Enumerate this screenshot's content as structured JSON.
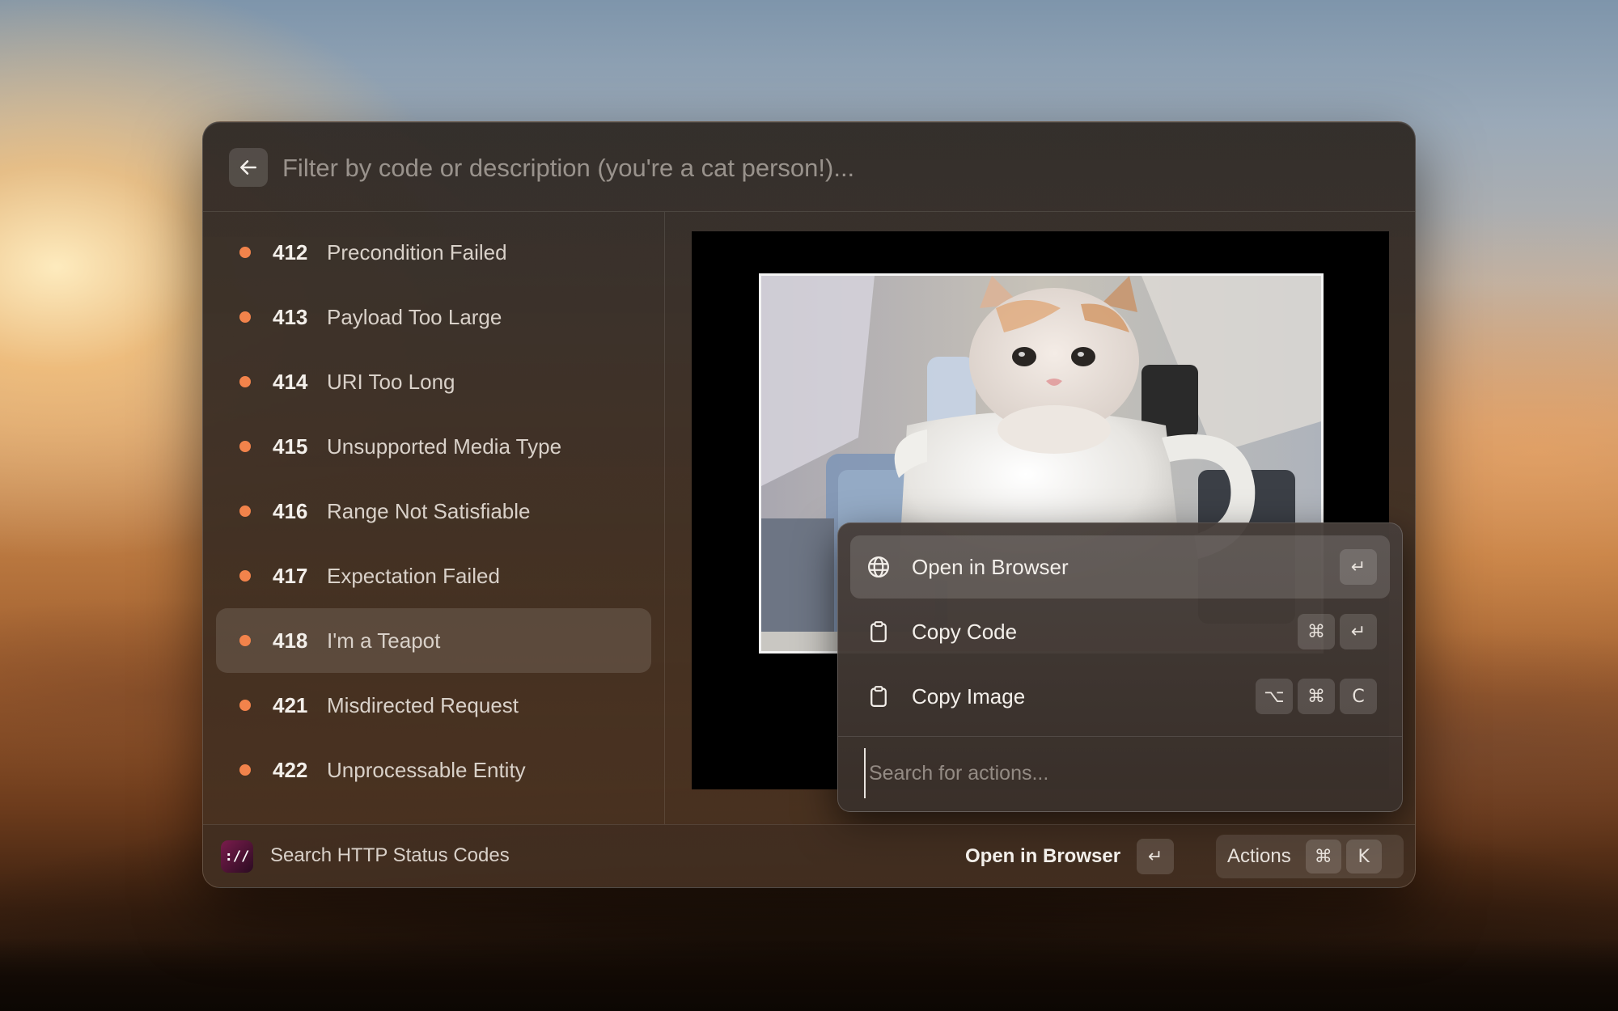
{
  "search": {
    "placeholder": "Filter by code or description (you're a cat person!)..."
  },
  "status_list": [
    {
      "code": "412",
      "description": "Precondition Failed"
    },
    {
      "code": "413",
      "description": "Payload Too Large"
    },
    {
      "code": "414",
      "description": "URI Too Long"
    },
    {
      "code": "415",
      "description": "Unsupported Media Type"
    },
    {
      "code": "416",
      "description": "Range Not Satisfiable"
    },
    {
      "code": "417",
      "description": "Expectation Failed"
    },
    {
      "code": "418",
      "description": "I'm a Teapot",
      "selected": true
    },
    {
      "code": "421",
      "description": "Misdirected Request"
    },
    {
      "code": "422",
      "description": "Unprocessable Entity"
    }
  ],
  "colors": {
    "status_dot": "#f2834b"
  },
  "preview": {
    "subject": "kitten in a teapot"
  },
  "actions_panel": {
    "items": [
      {
        "label": "Open in Browser",
        "icon": "globe-icon",
        "shortcut": [
          "↵"
        ],
        "selected": true
      },
      {
        "label": "Copy Code",
        "icon": "clipboard-icon",
        "shortcut": [
          "⌘",
          "↵"
        ]
      },
      {
        "label": "Copy Image",
        "icon": "clipboard-icon",
        "shortcut": [
          "⌥",
          "⌘",
          "C"
        ]
      }
    ],
    "search_placeholder": "Search for actions..."
  },
  "footer": {
    "extension_icon_text": "://",
    "extension_title": "Search HTTP Status Codes",
    "primary_action_label": "Open in Browser",
    "primary_action_key": "↵",
    "actions_label": "Actions",
    "actions_keys": [
      "⌘",
      "K"
    ]
  }
}
